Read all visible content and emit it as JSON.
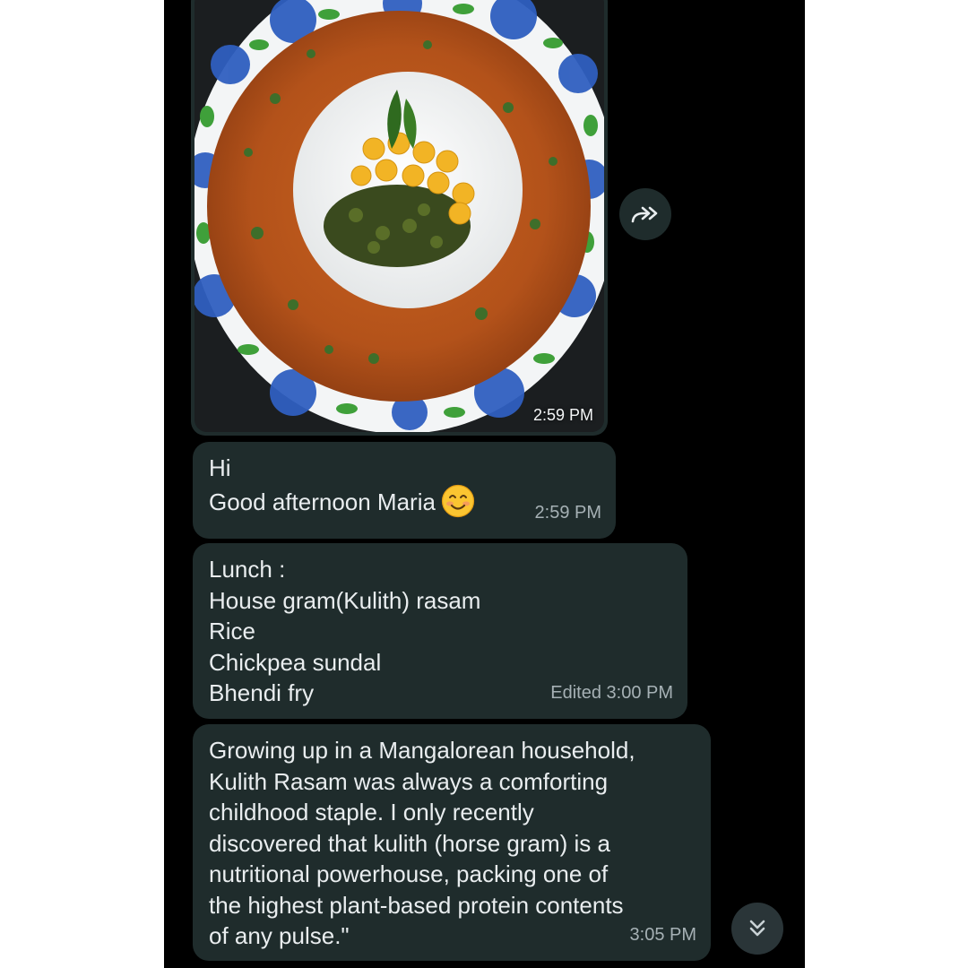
{
  "messages": {
    "image": {
      "time": "2:59 PM",
      "icon": "food-photo"
    },
    "greeting": {
      "lines": [
        "Hi",
        "Good afternoon Maria"
      ],
      "emoji": "smiling-face-emoji",
      "time": "2:59 PM"
    },
    "lunch": {
      "lines": [
        "Lunch :",
        "House gram(Kulith) rasam",
        "Rice",
        "Chickpea sundal",
        "Bhendi fry"
      ],
      "meta": "Edited 3:00 PM"
    },
    "story": {
      "lines": [
        "Growing up in a Mangalorean household,",
        "Kulith Rasam was always a comforting",
        "childhood staple. I only recently",
        "discovered that kulith (horse gram) is a",
        "nutritional powerhouse, packing one of",
        "the highest plant-based protein contents",
        "of any pulse.\""
      ],
      "time": "3:05 PM"
    }
  },
  "controls": {
    "forward_icon": "forward-icon",
    "scroll_icon": "double-chevron-down-icon"
  },
  "colors": {
    "background": "#000000",
    "bubble": "#1f2c2c",
    "text": "#e9edef",
    "meta": "#a6b1b5",
    "rasam": "#b5531c",
    "plate_flower": "#2f5fc0"
  }
}
